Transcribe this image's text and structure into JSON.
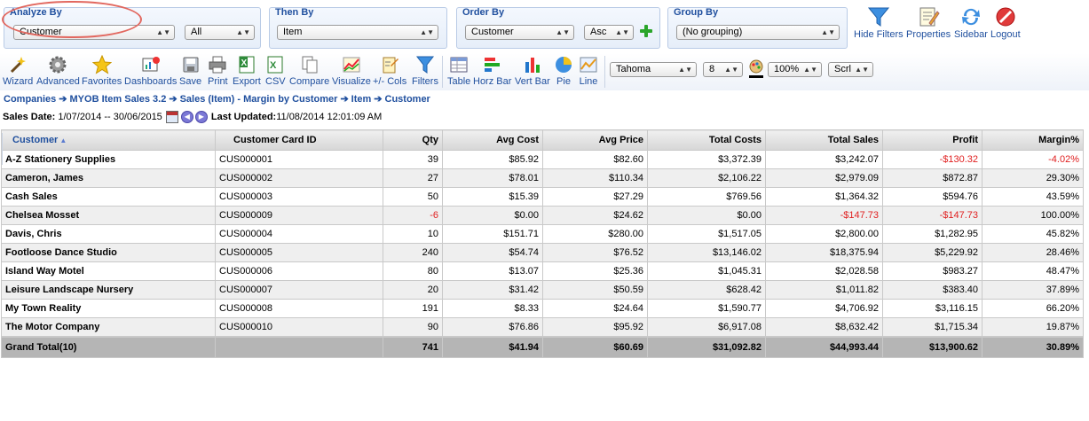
{
  "filters": {
    "analyze_by": {
      "label": "Analyze By",
      "value": "Customer",
      "secondary": "All"
    },
    "then_by": {
      "label": "Then By",
      "value": "Item"
    },
    "order_by": {
      "label": "Order By",
      "value": "Customer",
      "direction": "Asc"
    },
    "group_by": {
      "label": "Group By",
      "value": "(No grouping)"
    }
  },
  "top_actions": [
    {
      "label": "Hide Filters",
      "icon": "funnel-icon"
    },
    {
      "label": "Properties",
      "icon": "properties-icon"
    },
    {
      "label": "Sidebar",
      "icon": "refresh-icon"
    },
    {
      "label": "Logout",
      "icon": "logout-icon"
    }
  ],
  "toolbar": {
    "buttons": [
      {
        "label": "Wizard",
        "icon": "wizard-icon"
      },
      {
        "label": "Advanced",
        "icon": "gear-icon"
      },
      {
        "label": "Favorites",
        "icon": "star-icon"
      },
      {
        "label": "Dashboards",
        "icon": "dashboards-icon"
      },
      {
        "label": "Save",
        "icon": "save-icon"
      },
      {
        "label": "Print",
        "icon": "print-icon"
      },
      {
        "label": "Export",
        "icon": "excel-icon"
      },
      {
        "label": "CSV",
        "icon": "csv-icon"
      },
      {
        "label": "Compare",
        "icon": "compare-icon"
      },
      {
        "label": "Visualize",
        "icon": "visualize-icon"
      },
      {
        "label": "+/- Cols",
        "icon": "columns-icon"
      },
      {
        "label": "Filters",
        "icon": "funnel-icon"
      },
      {
        "label": "Table",
        "icon": "table-icon"
      },
      {
        "label": "Horz Bar",
        "icon": "horz-bar-icon"
      },
      {
        "label": "Vert Bar",
        "icon": "vert-bar-icon"
      },
      {
        "label": "Pie",
        "icon": "pie-icon"
      },
      {
        "label": "Line",
        "icon": "line-icon"
      }
    ],
    "font": "Tahoma",
    "font_size": "8",
    "zoom": "100%",
    "scroll": "Scrl"
  },
  "breadcrumb": [
    "Companies",
    "MYOB Item Sales 3.2",
    "Sales (Item) - Margin by Customer",
    "Item",
    "Customer"
  ],
  "dates": {
    "sales_label": "Sales Date:",
    "sales_range": "1/07/2014 -- 30/06/2015",
    "updated_label": "Last Updated:",
    "updated_value": "11/08/2014 12:01:09 AM"
  },
  "table": {
    "columns": [
      "Customer",
      "Customer Card ID",
      "Qty",
      "Avg Cost",
      "Avg Price",
      "Total Costs",
      "Total Sales",
      "Profit",
      "Margin%"
    ],
    "rows": [
      {
        "customer": "A-Z Stationery Supplies",
        "id": "CUS000001",
        "qty": "39",
        "avg_cost": "$85.92",
        "avg_price": "$82.60",
        "total_costs": "$3,372.39",
        "total_sales": "$3,242.07",
        "profit": "-$130.32",
        "margin": "-4.02%",
        "neg": [
          "profit",
          "margin"
        ]
      },
      {
        "customer": "Cameron, James",
        "id": "CUS000002",
        "qty": "27",
        "avg_cost": "$78.01",
        "avg_price": "$110.34",
        "total_costs": "$2,106.22",
        "total_sales": "$2,979.09",
        "profit": "$872.87",
        "margin": "29.30%",
        "neg": []
      },
      {
        "customer": "Cash Sales",
        "id": "CUS000003",
        "qty": "50",
        "avg_cost": "$15.39",
        "avg_price": "$27.29",
        "total_costs": "$769.56",
        "total_sales": "$1,364.32",
        "profit": "$594.76",
        "margin": "43.59%",
        "neg": []
      },
      {
        "customer": "Chelsea Mosset",
        "id": "CUS000009",
        "qty": "-6",
        "avg_cost": "$0.00",
        "avg_price": "$24.62",
        "total_costs": "$0.00",
        "total_sales": "-$147.73",
        "profit": "-$147.73",
        "margin": "100.00%",
        "neg": [
          "qty",
          "total_sales",
          "profit"
        ]
      },
      {
        "customer": "Davis, Chris",
        "id": "CUS000004",
        "qty": "10",
        "avg_cost": "$151.71",
        "avg_price": "$280.00",
        "total_costs": "$1,517.05",
        "total_sales": "$2,800.00",
        "profit": "$1,282.95",
        "margin": "45.82%",
        "neg": []
      },
      {
        "customer": "Footloose Dance Studio",
        "id": "CUS000005",
        "qty": "240",
        "avg_cost": "$54.74",
        "avg_price": "$76.52",
        "total_costs": "$13,146.02",
        "total_sales": "$18,375.94",
        "profit": "$5,229.92",
        "margin": "28.46%",
        "neg": []
      },
      {
        "customer": "Island Way Motel",
        "id": "CUS000006",
        "qty": "80",
        "avg_cost": "$13.07",
        "avg_price": "$25.36",
        "total_costs": "$1,045.31",
        "total_sales": "$2,028.58",
        "profit": "$983.27",
        "margin": "48.47%",
        "neg": []
      },
      {
        "customer": "Leisure Landscape Nursery",
        "id": "CUS000007",
        "qty": "20",
        "avg_cost": "$31.42",
        "avg_price": "$50.59",
        "total_costs": "$628.42",
        "total_sales": "$1,011.82",
        "profit": "$383.40",
        "margin": "37.89%",
        "neg": []
      },
      {
        "customer": "My Town Reality",
        "id": "CUS000008",
        "qty": "191",
        "avg_cost": "$8.33",
        "avg_price": "$24.64",
        "total_costs": "$1,590.77",
        "total_sales": "$4,706.92",
        "profit": "$3,116.15",
        "margin": "66.20%",
        "neg": []
      },
      {
        "customer": "The Motor Company",
        "id": "CUS000010",
        "qty": "90",
        "avg_cost": "$76.86",
        "avg_price": "$95.92",
        "total_costs": "$6,917.08",
        "total_sales": "$8,632.42",
        "profit": "$1,715.34",
        "margin": "19.87%",
        "neg": []
      }
    ],
    "total": {
      "label": "Grand Total(10)",
      "qty": "741",
      "avg_cost": "$41.94",
      "avg_price": "$60.69",
      "total_costs": "$31,092.82",
      "total_sales": "$44,993.44",
      "profit": "$13,900.62",
      "margin": "30.89%"
    }
  },
  "colors": {
    "accent": "#1f4f9e",
    "negative": "#e02020",
    "highlight_oval": "#e2685f"
  }
}
